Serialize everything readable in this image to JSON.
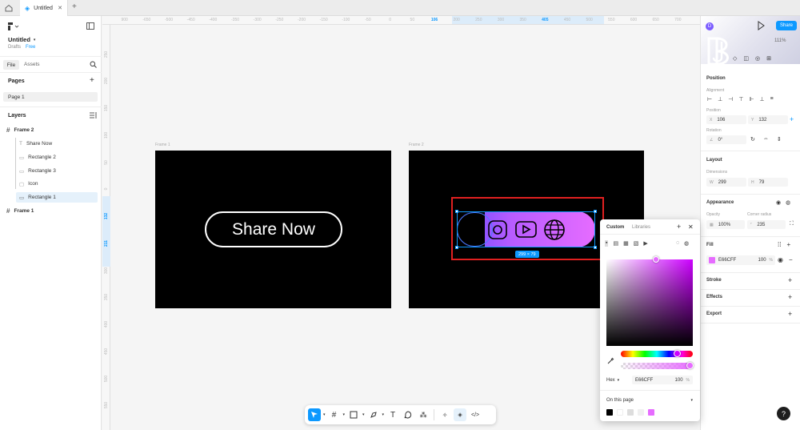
{
  "tabs": {
    "file_name": "Untitled",
    "add": "+"
  },
  "file": {
    "name": "Untitled",
    "location": "Drafts",
    "plan": "Free"
  },
  "left_tabs": {
    "file": "File",
    "assets": "Assets"
  },
  "pages": {
    "title": "Pages",
    "items": [
      "Page 1"
    ]
  },
  "layers": {
    "title": "Layers",
    "items": [
      {
        "label": "Frame 2",
        "kind": "frame"
      },
      {
        "label": "Share Now",
        "kind": "text"
      },
      {
        "label": "Rectangle 2",
        "kind": "rect"
      },
      {
        "label": "Rectangle 3",
        "kind": "rect"
      },
      {
        "label": "Icon",
        "kind": "group"
      },
      {
        "label": "Rectangle 1",
        "kind": "rect"
      },
      {
        "label": "Frame 1",
        "kind": "frame"
      }
    ]
  },
  "ruler_top": [
    "900",
    "-650",
    "-500",
    "-450",
    "-400",
    "-350",
    "-300",
    "-250",
    "-200",
    "-150",
    "-100",
    "-50",
    "0",
    "50",
    "106",
    "200",
    "250",
    "300",
    "350",
    "405",
    "450",
    "500",
    "550",
    "600",
    "650",
    "700"
  ],
  "ruler_left": [
    "250",
    "200",
    "150",
    "100",
    "50",
    "0",
    "132",
    "211",
    "300",
    "350",
    "400",
    "450",
    "500",
    "550"
  ],
  "canvas": {
    "frame1_label": "Frame 1",
    "frame2_label": "Frame 2",
    "button_text": "Share Now",
    "size_badge": "299 × 79"
  },
  "right": {
    "share": "Share",
    "zoom": "111%",
    "position_title": "Position",
    "alignment_label": "Alignment",
    "position_label": "Position",
    "x_label": "X",
    "x_value": "106",
    "y_label": "Y",
    "y_value": "132",
    "rotation_label": "Rotation",
    "rotation_value": "0°",
    "layout_title": "Layout",
    "dimensions_label": "Dimensions",
    "w_label": "W",
    "w_value": "299",
    "h_label": "H",
    "h_value": "79",
    "appearance_title": "Appearance",
    "opacity_label": "Opacity",
    "opacity_value": "100%",
    "radius_label": "Corner radius",
    "radius_value": "235",
    "fill_title": "Fill",
    "fill_hex": "E66CFF",
    "fill_opacity": "100",
    "fill_pct": "%",
    "stroke_title": "Stroke",
    "effects_title": "Effects",
    "export_title": "Export",
    "help": "?"
  },
  "picker": {
    "tab_custom": "Custom",
    "tab_libraries": "Libraries",
    "format": "Hex",
    "hex": "E66CFF",
    "opacity": "100",
    "pct": "%",
    "scope": "On this page"
  },
  "colors": {
    "accent": "#0d99ff",
    "fill": "#E66CFF",
    "gradient_start": "#7b5cff",
    "highlight": "#e02020"
  }
}
